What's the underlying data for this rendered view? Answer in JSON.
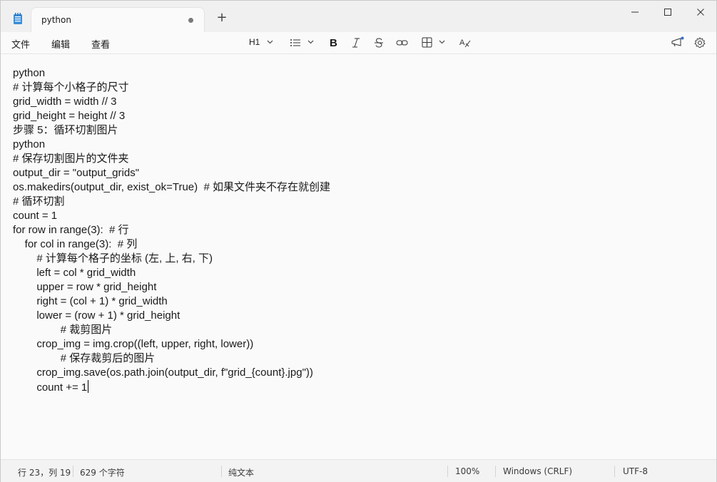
{
  "tab": {
    "title": "python"
  },
  "menu": {
    "file": "文件",
    "edit": "编辑",
    "view": "查看"
  },
  "toolbar": {
    "heading": "H1"
  },
  "editor": {
    "lines": [
      "python",
      "# 计算每个小格子的尺寸",
      "grid_width = width // 3",
      "grid_height = height // 3",
      "步骤 5：循环切割图片",
      "python",
      "# 保存切割图片的文件夹",
      "output_dir = \"output_grids\"",
      "os.makedirs(output_dir, exist_ok=True)  # 如果文件夹不存在就创建",
      "# 循环切割",
      "count = 1",
      "for row in range(3):  # 行",
      "    for col in range(3):  # 列",
      "        # 计算每个格子的坐标 (左, 上, 右, 下)",
      "        left = col * grid_width",
      "        upper = row * grid_height",
      "        right = (col + 1) * grid_width",
      "        lower = (row + 1) * grid_height",
      "                # 裁剪图片",
      "        crop_img = img.crop((left, upper, right, lower))",
      "                # 保存裁剪后的图片",
      "        crop_img.save(os.path.join(output_dir, f\"grid_{count}.jpg\"))",
      "        count += 1"
    ]
  },
  "status": {
    "position": "行 23，列 19",
    "chars": "629 个字符",
    "format": "纯文本",
    "zoom": "100%",
    "line_ending": "Windows (CRLF)",
    "encoding": "UTF-8"
  }
}
